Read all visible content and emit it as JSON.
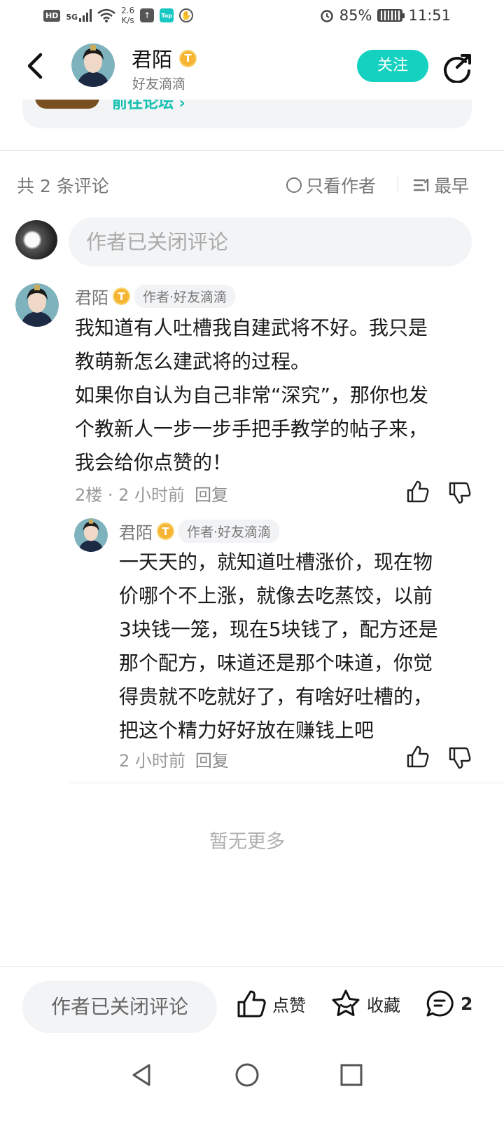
{
  "status_bar": {
    "hd": "HD",
    "network": "5G",
    "speed_value": "2.6",
    "speed_unit": "K/s",
    "top_app": "Top",
    "battery": "85%",
    "time": "11:51"
  },
  "header": {
    "username": "君陌",
    "badge": "T",
    "subtitle": "好友滴滴",
    "follow_label": "关注"
  },
  "peek_card": {
    "link_text": "前往论坛 ›"
  },
  "comments_toolbar": {
    "count_label": "共 2 条评论",
    "author_only_label": "只看作者",
    "sort_label": "最早"
  },
  "comment_input": {
    "placeholder": "作者已关闭评论"
  },
  "comments": [
    {
      "name": "君陌",
      "badge": "T",
      "tag": "作者·好友滴滴",
      "line1": "我知道有人吐槽我自建武将不好。我只是",
      "line2": "教萌新怎么建武将的过程。",
      "line3": "如果你自认为自己非常“深究”，那你也发",
      "line4": "个教新人一步一步手把手教学的帖子来，",
      "line5": "我会给你点赞的！",
      "meta": "2楼 · 2 小时前",
      "reply_label": "回复"
    }
  ],
  "replies": [
    {
      "name": "君陌",
      "badge": "T",
      "tag": "作者·好友滴滴",
      "line1": "一天天的，就知道吐槽涨价，现在物",
      "line2": "价哪个不上涨，就像去吃蒸饺，以前",
      "line3": "3块钱一笼，现在5块钱了，配方还是",
      "line4": "那个配方，味道还是那个味道，你觉",
      "line5": "得贵就不吃就好了，有啥好吐槽的，",
      "line6": "把这个精力好好放在赚钱上吧",
      "meta": "2 小时前",
      "reply_label": "回复"
    }
  ],
  "no_more_label": "暂无更多",
  "bottom_bar": {
    "input_label": "作者已关闭评论",
    "like_label": "点赞",
    "favorite_label": "收藏",
    "comment_count": "2"
  },
  "colors": {
    "accent": "#15d1bf",
    "badge_gold": "#f5b532",
    "muted_text": "#777777"
  }
}
